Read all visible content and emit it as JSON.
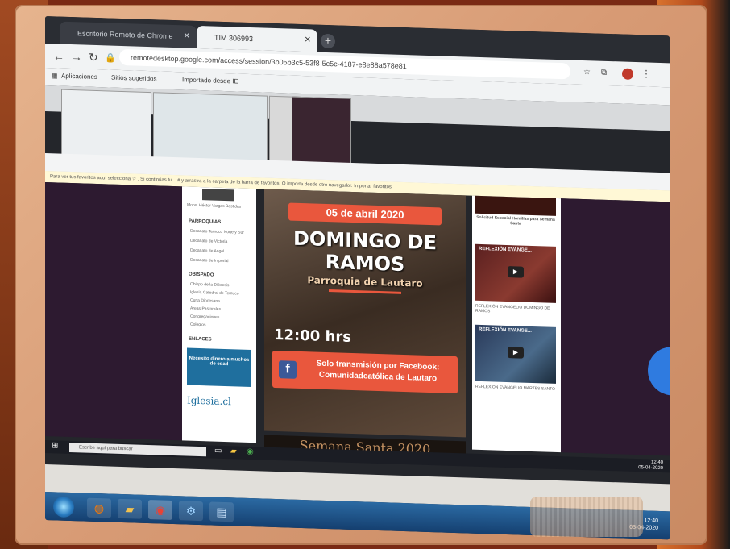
{
  "browser": {
    "tabs": [
      {
        "label": "Escritorio Remoto de Chrome"
      },
      {
        "label": "TIM 306993"
      }
    ],
    "url": "remotedesktop.google.com/access/session/3b05b3c5-53f8-5c5c-4187-e8e88a578e81",
    "bookmarks": [
      "Aplicaciones",
      "Sitios sugeridos",
      "Importado desde IE"
    ]
  },
  "remote": {
    "notice": "Para ver tus favoritos aquí selecciona ☆ . Si continúas tu... # y arrastra a la carpeta de la barra de favoritos. O importa desde otro navegador. Importar favoritos",
    "sidebar": {
      "author": "Mons. Héctor Vargas Bastidas",
      "sections": [
        {
          "title": "PARROQUIAS",
          "items": [
            "Decanato Temuco Norte y Sur",
            "Decanato de Victoria",
            "Decanato de Angol",
            "Decanato de Imperial"
          ]
        },
        {
          "title": "OBISPADO",
          "items": [
            "Obispo de la Diócesis",
            "Iglesia Catedral de Temuco",
            "Curia Diocesana",
            "Áreas Pastorales",
            "Congregaciones",
            "Colegios"
          ]
        },
        {
          "title": "ENLACES",
          "items": []
        }
      ],
      "links": {
        "vocations": "Necesito dinero a muchos de edad",
        "iglesia": "Iglesia.cl"
      }
    },
    "poster": {
      "date": "05 de abril 2020",
      "title_line1": "DOMINGO DE",
      "title_line2": "RAMOS",
      "subtitle": "Parroquia de Lautaro",
      "time": "12:00 hrs",
      "fb_line1": "Solo transmisión por Facebook:",
      "fb_line2": "Comunidadcatólica de Lautaro",
      "footer": "Semana Santa 2020"
    },
    "rightcol": {
      "top_label": "Solicitud Especial Homilías para Semana Santa",
      "videos": [
        {
          "title": "REFLEXIÓN EVANGE...",
          "caption": "REFLEXIÓN EVANGELIO DOMINGO DE RAMOS"
        },
        {
          "title": "REFLEXIÓN EVANGE...",
          "caption": "REFLEXIÓN EVANGELIO MARTES SANTO"
        }
      ]
    },
    "search_placeholder": "Escribe aquí para buscar",
    "clock": {
      "time": "12:40",
      "date": "05-04-2020"
    }
  },
  "host": {
    "clock": {
      "time": "12:40",
      "date": "05-04-2020"
    }
  }
}
